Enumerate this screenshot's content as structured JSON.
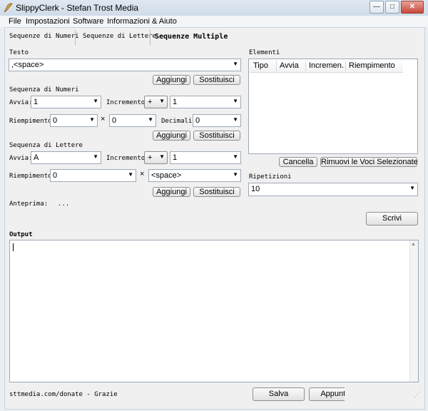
{
  "window": {
    "title": "SlippyClerk - Stefan Trost Media",
    "minimize": "—",
    "maximize": "□",
    "close": "✕"
  },
  "menu": [
    "File",
    "Impostazioni",
    "Software",
    "Informazioni & Aiuto"
  ],
  "tabs": [
    "Sequenze di Numeri",
    "Sequenze di Lettere",
    "Sequenze Multiple"
  ],
  "testo": {
    "label": "Testo",
    "value": ",<space>",
    "add": "Aggiungi",
    "replace": "Sostituisci"
  },
  "numeri": {
    "label": "Sequenza di Numeri",
    "avvia_label": "Avvia:",
    "avvia_value": "1",
    "incremento_label": "Incremento:",
    "operator": "+",
    "incremento_value": "1",
    "riempimento_label": "Riempimento:",
    "riempimento_value": "0",
    "times": "×",
    "riempimento_count": "0",
    "decimali_label": "Decimali:",
    "decimali_value": "0",
    "add": "Aggiungi",
    "replace": "Sostituisci"
  },
  "lettere": {
    "label": "Sequenza di Lettere",
    "avvia_label": "Avvia:",
    "avvia_value": "A",
    "incremento_label": "Incremento:",
    "operator": "+",
    "incremento_value": "1",
    "riempimento_label": "Riempimento:",
    "riempimento_value": "0",
    "times": "×",
    "riempimento_char": "<space>",
    "add": "Aggiungi",
    "replace": "Sostituisci"
  },
  "anteprima": {
    "label": "Anteprima:",
    "value": "..."
  },
  "elementi": {
    "label": "Elementi",
    "columns": [
      "Tipo",
      "Avvia",
      "Incremen...",
      "Riempimento"
    ],
    "delete": "Cancella",
    "remove_selected": "Rimuovi le Voci Selezionate"
  },
  "ripetizioni": {
    "label": "Ripetizioni",
    "value": "10"
  },
  "write_button": "Scrivi",
  "output": {
    "label": "Output",
    "value": ""
  },
  "footer": {
    "donate": "sttmedia.com/donate - Grazie",
    "save": "Salva",
    "append": "Appunti"
  },
  "icons": {
    "app": "slippyclerk-app-icon",
    "dropdown": "chevron-down-icon"
  }
}
